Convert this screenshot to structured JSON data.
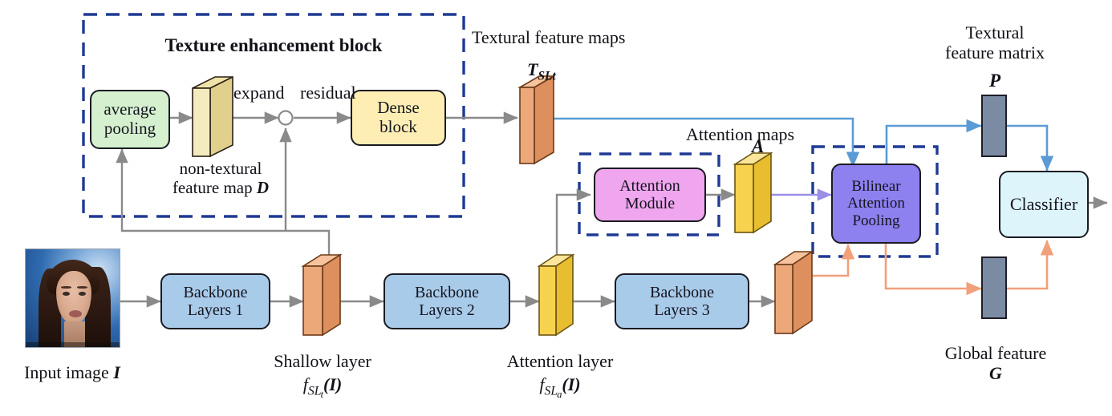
{
  "figure": {
    "title": "Texture enhancement block diagram",
    "dashed_group_label": "Texture enhancement block"
  },
  "colors": {
    "dashed_border": "#1f3a93",
    "arrow_gray": "#8a8a8a",
    "arrow_blue": "#5b9bd5",
    "arrow_orange": "#f0a07a",
    "arrow_purple": "#9a8ee8",
    "avg_pool_fill": "#d4f0cf",
    "dense_block_fill": "#ffeeb3",
    "backbone_fill": "#a9cbea",
    "attention_module_fill": "#efa6ee",
    "bilinear_fill": "#8d80ef",
    "classifier_fill": "#ddf4fb",
    "orange_box": "#eda87a",
    "yellow_box": "#f6d24f",
    "khaki_box": "#efe3a8",
    "vector_fill": "#7b8ba3"
  },
  "blocks": {
    "texture_enhancement": "Texture enhancement block",
    "average_pooling": "average\npooling",
    "average_pooling_line1": "average",
    "average_pooling_line2": "pooling",
    "dense_block_line1": "Dense",
    "dense_block_line2": "block",
    "attention_module_line1": "Attention",
    "attention_module_line2": "Module",
    "bilinear_line1": "Bilinear",
    "bilinear_line2": "Attention",
    "bilinear_line3": "Pooling",
    "classifier": "Classifier",
    "backbone1_line1": "Backbone",
    "backbone1_line2": "Layers 1",
    "backbone2_line1": "Backbone",
    "backbone2_line2": "Layers 2",
    "backbone3_line1": "Backbone",
    "backbone3_line2": "Layers 3"
  },
  "edge_labels": {
    "expand": "expand",
    "residual": "residual"
  },
  "labels": {
    "non_textural_line1": "non-textural",
    "non_textural_line2": "feature map",
    "non_textural_symbol": "D",
    "textural_feature_maps": "Textural feature maps",
    "textural_symbol_base": "T",
    "textural_symbol_sub": "SLt",
    "attention_maps": "Attention maps",
    "attention_symbol": "A",
    "textural_feature_matrix_line1": "Textural",
    "textural_feature_matrix_line2": "feature matrix",
    "textural_matrix_symbol": "P",
    "global_feature_line1": "Global feature",
    "global_feature_symbol": "G",
    "input_image_text": "Input image",
    "input_image_symbol": "I",
    "shallow_layer_text": "Shallow layer",
    "shallow_layer_fn_base": "f",
    "shallow_layer_fn_sub": "SL",
    "shallow_layer_fn_sub2": "t",
    "shallow_layer_fn_arg": "(I)",
    "attention_layer_text": "Attention layer",
    "attention_layer_fn_base": "f",
    "attention_layer_fn_sub": "SL",
    "attention_layer_fn_sub2": "a",
    "attention_layer_fn_arg": "(I)"
  }
}
